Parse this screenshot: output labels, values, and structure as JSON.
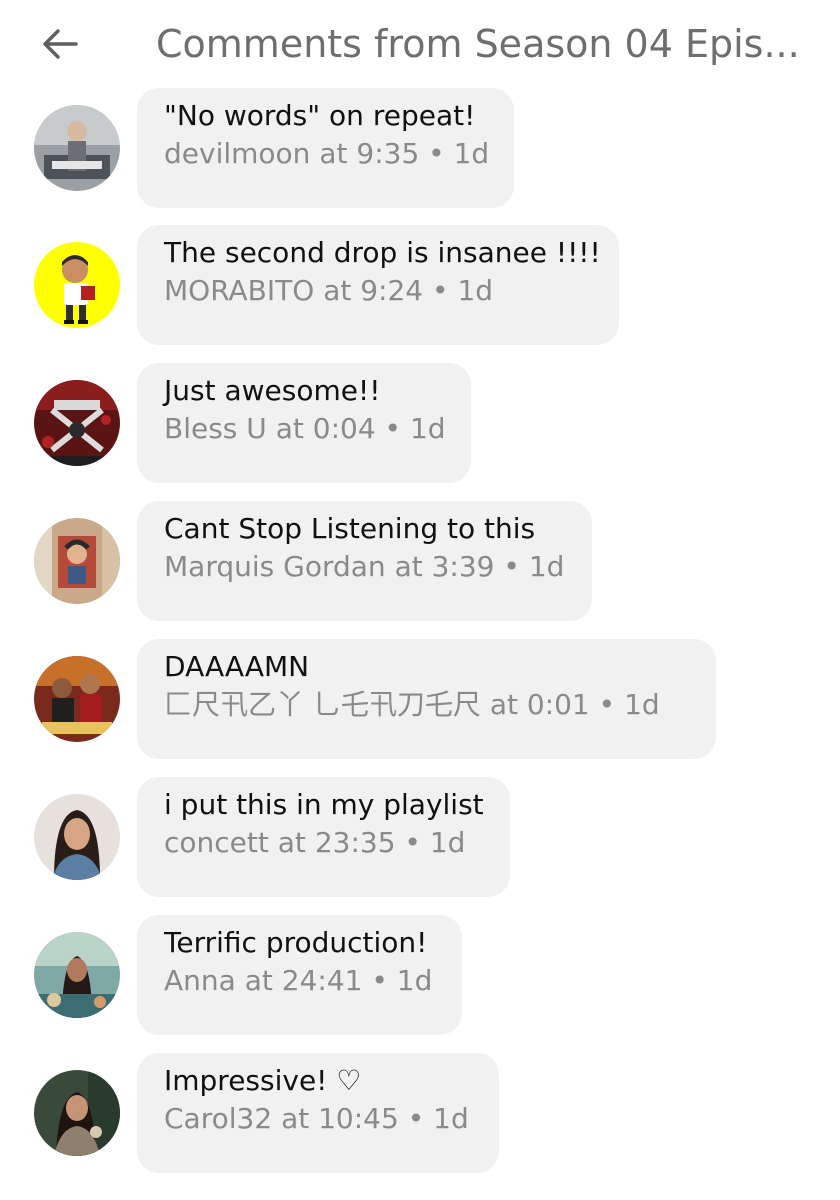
{
  "header": {
    "title": "Comments from Season 04 Epis..."
  },
  "comments": [
    {
      "text": "\"No words\" on repeat!",
      "user": "devilmoon",
      "time": "9:35",
      "age": "1d"
    },
    {
      "text": "The second drop is insanee !!!!",
      "user": "MORABITO",
      "time": "9:24",
      "age": "1d"
    },
    {
      "text": "Just awesome!!",
      "user": "Bless U",
      "time": "0:04",
      "age": "1d"
    },
    {
      "text": "Cant Stop Listening to this",
      "user": "Marquis Gordan",
      "time": "3:39",
      "age": "1d"
    },
    {
      "text": "DAAAAMN",
      "user": "匚尺卂乙丫 乚乇卂刀乇尺",
      "time": "0:01",
      "age": "1d"
    },
    {
      "text": "i put this in my playlist",
      "user": "concett",
      "time": "23:35",
      "age": "1d"
    },
    {
      "text": "Terrific production!",
      "user": "Anna",
      "time": "24:41",
      "age": "1d"
    },
    {
      "text": "Impressive! ♡",
      "user": "Carol32",
      "time": "10:45",
      "age": "1d"
    }
  ],
  "labels": {
    "at": "at",
    "separator": "•"
  },
  "colors": {
    "title": "#6e6e6e",
    "bubble": "#f1f1f1",
    "meta": "#8a8a8a",
    "avatar_yellow": "#ffff00"
  },
  "icons": {
    "back": "arrow-left-icon"
  }
}
